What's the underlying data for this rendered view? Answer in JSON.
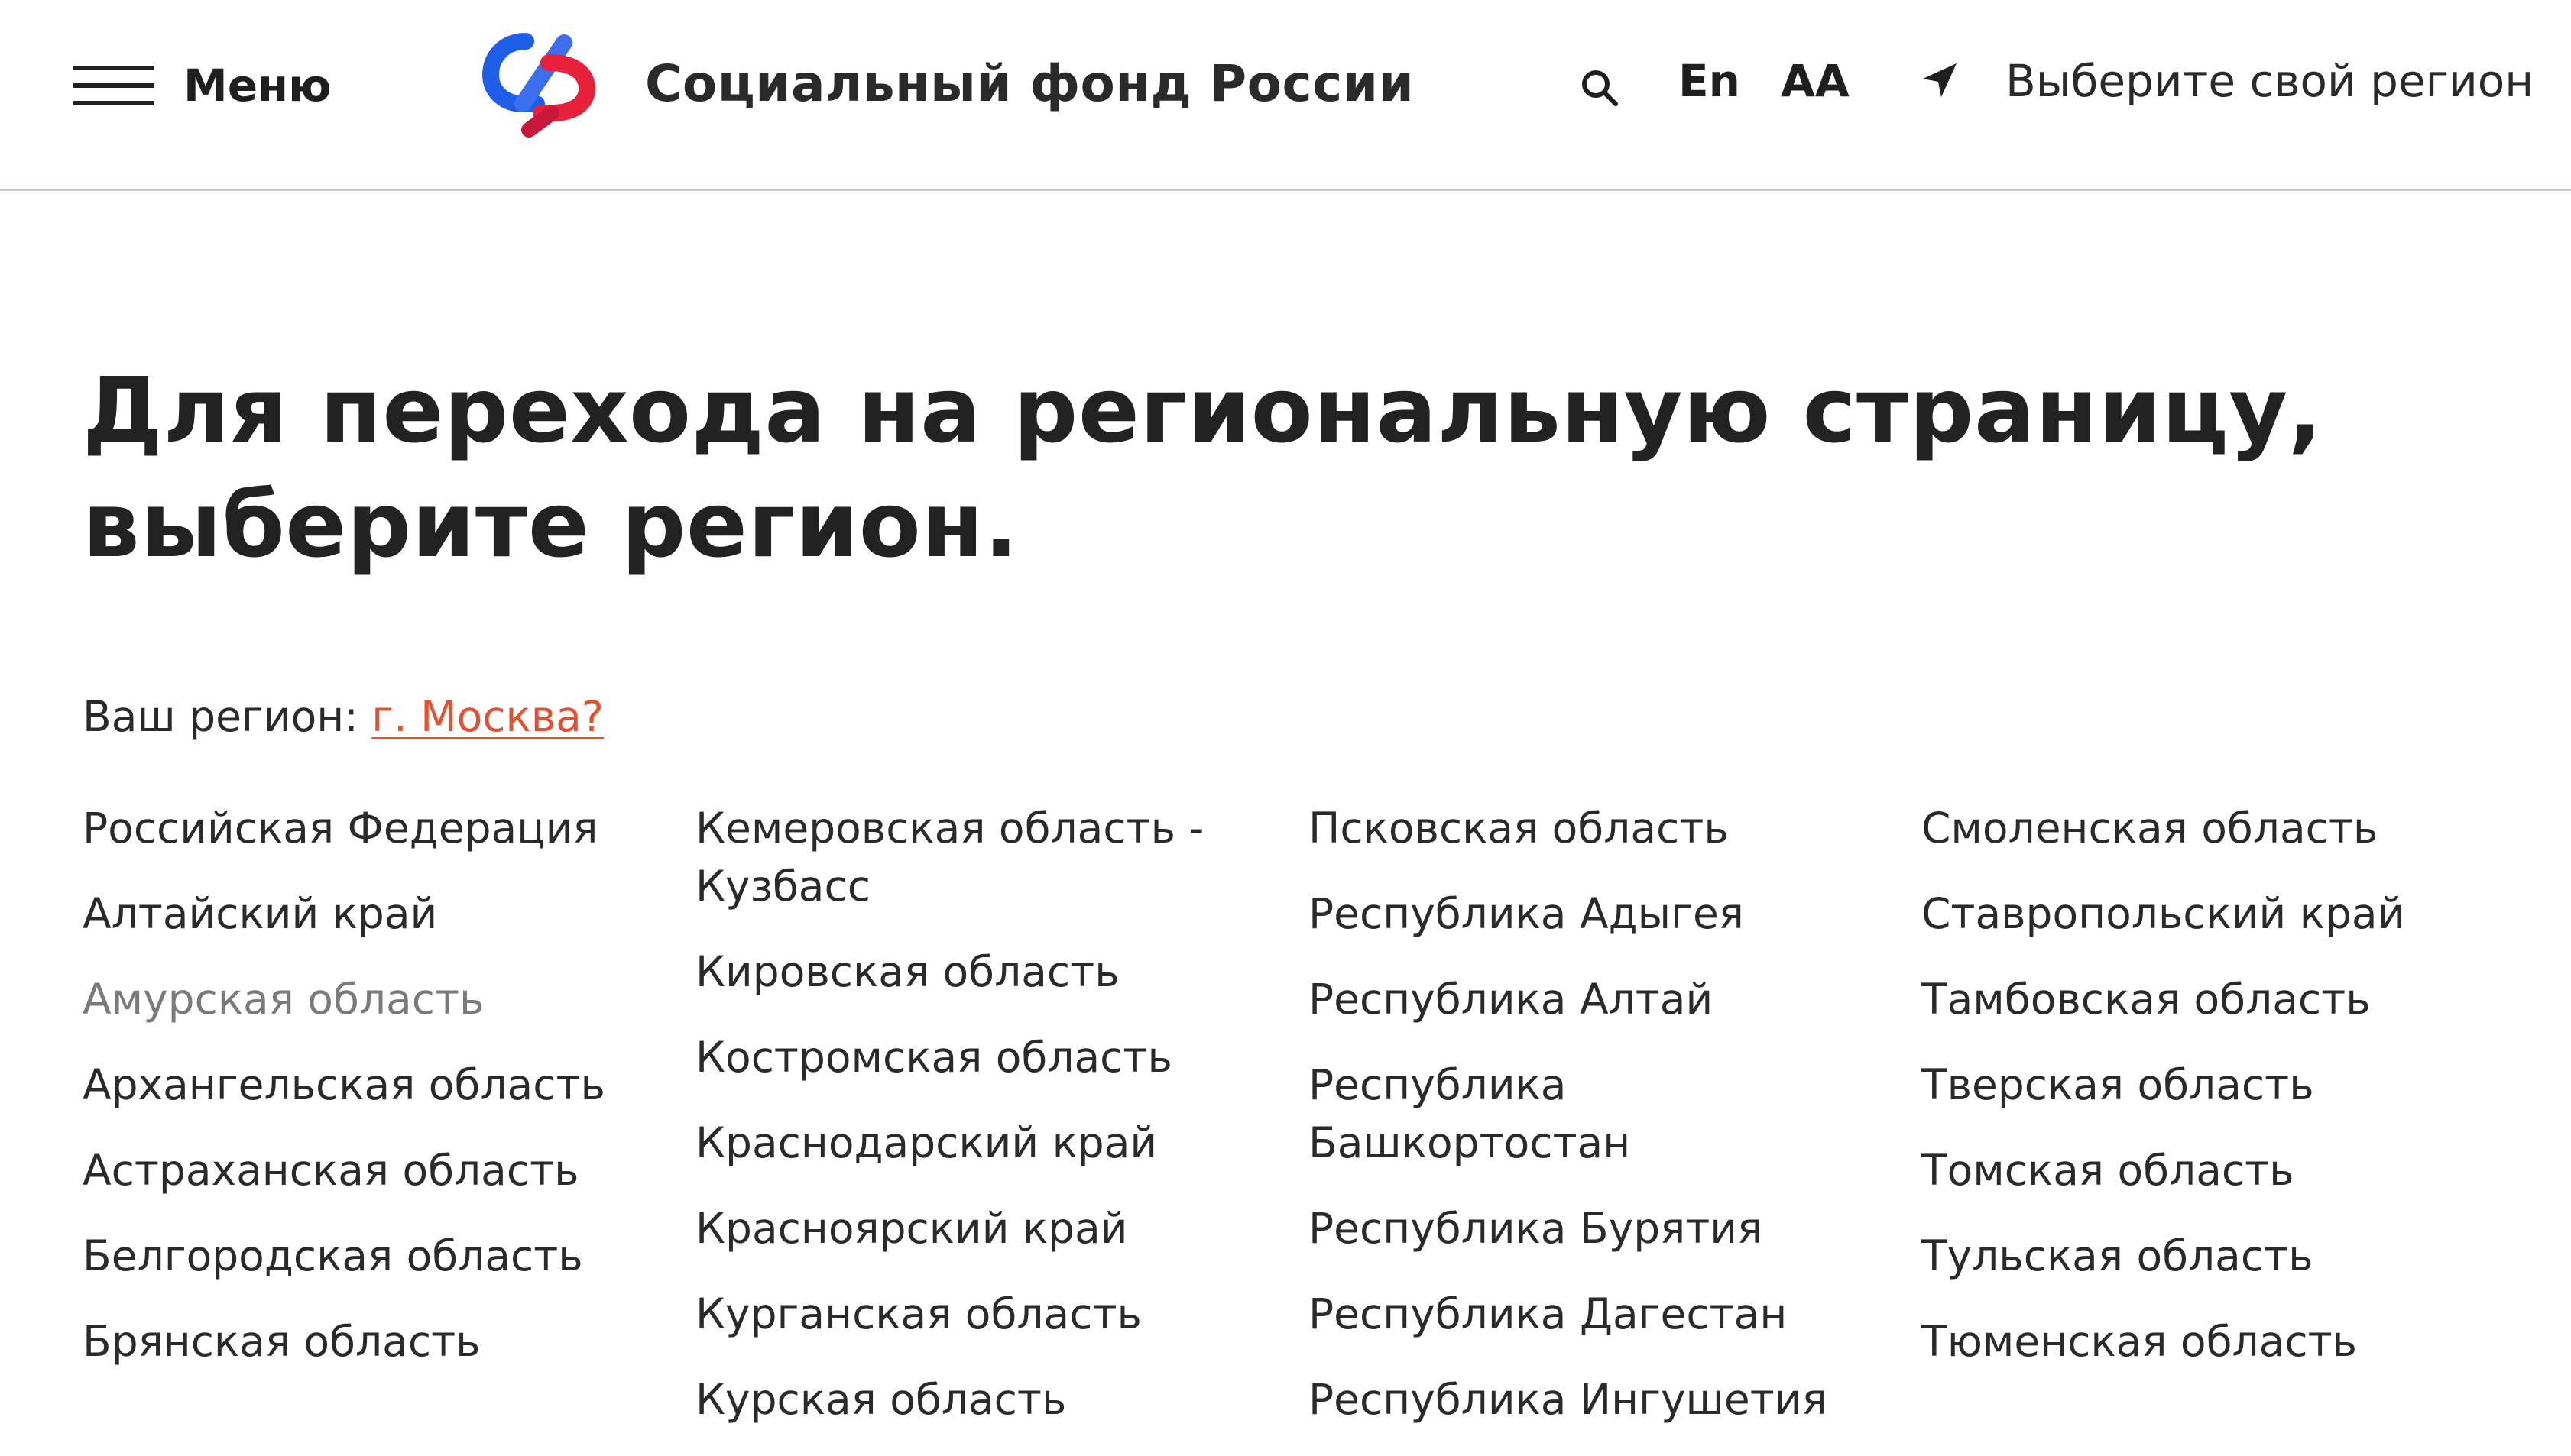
{
  "header": {
    "menu_label": "Меню",
    "brand_name": "Социальный фонд России",
    "lang_label": "En",
    "font_size_label": "АА",
    "region_select_label": "Выберите свой регион"
  },
  "brand_colors": {
    "blue": "#1f5ee8",
    "red": "#e8213a"
  },
  "icons": {
    "menu": "burger-icon",
    "search": "search-icon",
    "region": "location-arrow-icon"
  },
  "main": {
    "title": "Для перехода на региональную страницу, выберите регион.",
    "your_region_label": "Ваш регион:",
    "your_region_link": "г. Москва?",
    "link_color": "#e4512f"
  },
  "regions": {
    "col1": [
      "Российская Федерация",
      "Алтайский край",
      "Амурская область",
      "Архангельская область",
      "Астраханская область",
      "Белгородская область",
      "Брянская область"
    ],
    "col2": [
      "Кемеровская область - Кузбасс",
      "Кировская область",
      "Костромская область",
      "Краснодарский край",
      "Красноярский край",
      "Курганская область",
      "Курская область"
    ],
    "col3": [
      "Псковская область",
      "Республика Адыгея",
      "Республика Алтай",
      "Республика Башкортостан",
      "Республика Бурятия",
      "Республика Дагестан",
      "Республика Ингушетия"
    ],
    "col4": [
      "Смоленская область",
      "Ставропольский край",
      "Тамбовская область",
      "Тверская область",
      "Томская область",
      "Тульская область",
      "Тюменская область"
    ]
  }
}
